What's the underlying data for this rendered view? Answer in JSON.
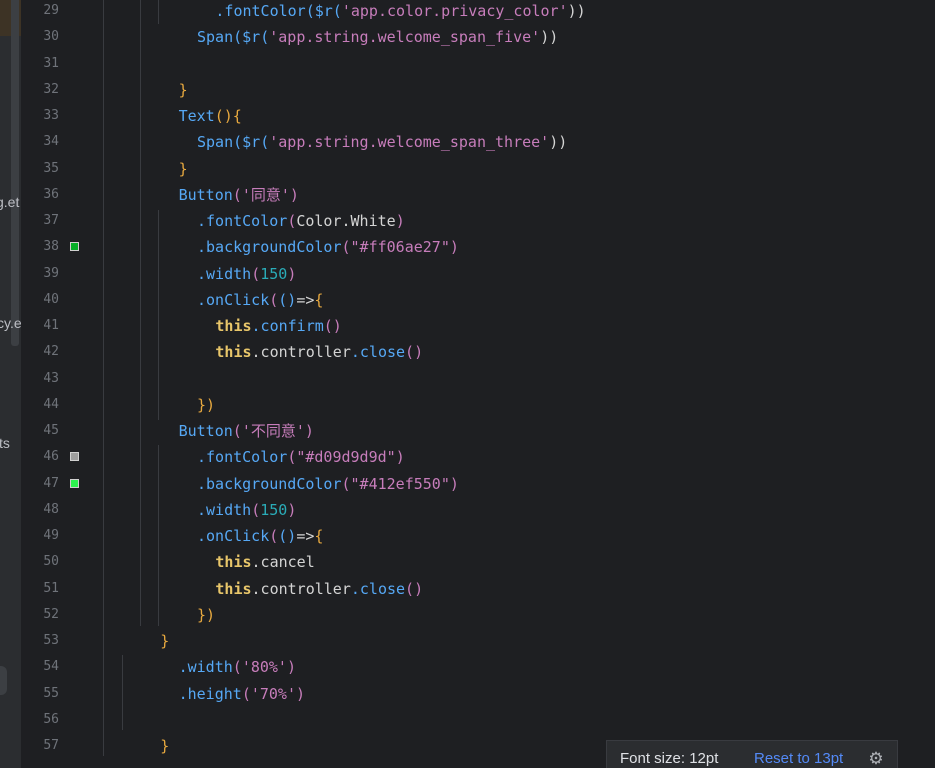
{
  "project_sidebar": {
    "fragments": [
      "g.et",
      "cy.e",
      "ts"
    ]
  },
  "editor": {
    "lines": [
      {
        "n": "29",
        "indent": 6,
        "tokens": [
          {
            "t": ".fontColor(",
            "c": "t-fn"
          },
          {
            "t": "$r(",
            "c": "t-fn"
          },
          {
            "t": "'app.color.privacy_color'",
            "c": "t-purple"
          },
          {
            "t": "))",
            "c": "t-white"
          }
        ]
      },
      {
        "n": "30",
        "indent": 5,
        "tokens": [
          {
            "t": "Span(",
            "c": "t-fn"
          },
          {
            "t": "$r(",
            "c": "t-fn"
          },
          {
            "t": "'app.string.welcome_span_five'",
            "c": "t-purple"
          },
          {
            "t": "))",
            "c": "t-white"
          }
        ]
      },
      {
        "n": "31",
        "indent": 0,
        "tokens": []
      },
      {
        "n": "32",
        "indent": 4,
        "tokens": [
          {
            "t": "}",
            "c": "t-bracket1"
          }
        ]
      },
      {
        "n": "33",
        "indent": 4,
        "tokens": [
          {
            "t": "Text",
            "c": "t-fn"
          },
          {
            "t": "()",
            "c": "t-bracket1"
          },
          {
            "t": "{",
            "c": "t-bracket1"
          }
        ]
      },
      {
        "n": "34",
        "indent": 5,
        "tokens": [
          {
            "t": "Span(",
            "c": "t-fn"
          },
          {
            "t": "$r(",
            "c": "t-fn"
          },
          {
            "t": "'app.string.welcome_span_three'",
            "c": "t-purple"
          },
          {
            "t": "))",
            "c": "t-white"
          }
        ]
      },
      {
        "n": "35",
        "indent": 4,
        "tokens": [
          {
            "t": "}",
            "c": "t-bracket1"
          }
        ]
      },
      {
        "n": "36",
        "indent": 4,
        "tokens": [
          {
            "t": "Button",
            "c": "t-fn"
          },
          {
            "t": "(",
            "c": "t-bracket2"
          },
          {
            "t": "'同意'",
            "c": "t-purple"
          },
          {
            "t": ")",
            "c": "t-bracket2"
          }
        ]
      },
      {
        "n": "37",
        "indent": 5,
        "tokens": [
          {
            "t": ".fontColor",
            "c": "t-fn"
          },
          {
            "t": "(",
            "c": "t-bracket2"
          },
          {
            "t": "Color.White",
            "c": "t-white"
          },
          {
            "t": ")",
            "c": "t-bracket2"
          }
        ]
      },
      {
        "n": "38",
        "indent": 5,
        "swatch": "#06ae27",
        "tokens": [
          {
            "t": ".backgroundColor",
            "c": "t-fn"
          },
          {
            "t": "(",
            "c": "t-bracket2"
          },
          {
            "t": "\"#ff06ae27\"",
            "c": "t-purple"
          },
          {
            "t": ")",
            "c": "t-bracket2"
          }
        ]
      },
      {
        "n": "39",
        "indent": 5,
        "tokens": [
          {
            "t": ".width",
            "c": "t-fn"
          },
          {
            "t": "(",
            "c": "t-bracket2"
          },
          {
            "t": "150",
            "c": "t-num"
          },
          {
            "t": ")",
            "c": "t-bracket2"
          }
        ]
      },
      {
        "n": "40",
        "indent": 5,
        "tokens": [
          {
            "t": ".onClick",
            "c": "t-fn"
          },
          {
            "t": "(",
            "c": "t-bracket2"
          },
          {
            "t": "()",
            "c": "t-fn"
          },
          {
            "t": "=>",
            "c": "t-white"
          },
          {
            "t": "{",
            "c": "t-bracket1"
          }
        ]
      },
      {
        "n": "41",
        "indent": 6,
        "tokens": [
          {
            "t": "this",
            "c": "t-this"
          },
          {
            "t": ".confirm",
            "c": "t-fn"
          },
          {
            "t": "()",
            "c": "t-bracket2"
          }
        ]
      },
      {
        "n": "42",
        "indent": 6,
        "tokens": [
          {
            "t": "this",
            "c": "t-this"
          },
          {
            "t": ".controller",
            "c": "t-white"
          },
          {
            "t": ".close",
            "c": "t-fn"
          },
          {
            "t": "()",
            "c": "t-bracket2"
          }
        ]
      },
      {
        "n": "43",
        "indent": 0,
        "tokens": []
      },
      {
        "n": "44",
        "indent": 5,
        "tokens": [
          {
            "t": "})",
            "c": "t-bracket1"
          }
        ]
      },
      {
        "n": "45",
        "indent": 4,
        "tokens": [
          {
            "t": "Button",
            "c": "t-fn"
          },
          {
            "t": "(",
            "c": "t-bracket2"
          },
          {
            "t": "'不同意'",
            "c": "t-purple"
          },
          {
            "t": ")",
            "c": "t-bracket2"
          }
        ]
      },
      {
        "n": "46",
        "indent": 5,
        "swatch": "#9d9d9d",
        "tokens": [
          {
            "t": ".fontColor",
            "c": "t-fn"
          },
          {
            "t": "(",
            "c": "t-bracket2"
          },
          {
            "t": "\"#d09d9d9d\"",
            "c": "t-purple"
          },
          {
            "t": ")",
            "c": "t-bracket2"
          }
        ]
      },
      {
        "n": "47",
        "indent": 5,
        "swatch": "#2ef550",
        "tokens": [
          {
            "t": ".backgroundColor",
            "c": "t-fn"
          },
          {
            "t": "(",
            "c": "t-bracket2"
          },
          {
            "t": "\"#412ef550\"",
            "c": "t-purple"
          },
          {
            "t": ")",
            "c": "t-bracket2"
          }
        ]
      },
      {
        "n": "48",
        "indent": 5,
        "tokens": [
          {
            "t": ".width",
            "c": "t-fn"
          },
          {
            "t": "(",
            "c": "t-bracket2"
          },
          {
            "t": "150",
            "c": "t-num"
          },
          {
            "t": ")",
            "c": "t-bracket2"
          }
        ]
      },
      {
        "n": "49",
        "indent": 5,
        "tokens": [
          {
            "t": ".onClick",
            "c": "t-fn"
          },
          {
            "t": "(",
            "c": "t-bracket2"
          },
          {
            "t": "()",
            "c": "t-fn"
          },
          {
            "t": "=>",
            "c": "t-white"
          },
          {
            "t": "{",
            "c": "t-bracket1"
          }
        ]
      },
      {
        "n": "50",
        "indent": 6,
        "tokens": [
          {
            "t": "this",
            "c": "t-this"
          },
          {
            "t": ".cancel",
            "c": "t-white"
          }
        ]
      },
      {
        "n": "51",
        "indent": 6,
        "tokens": [
          {
            "t": "this",
            "c": "t-this"
          },
          {
            "t": ".controller",
            "c": "t-white"
          },
          {
            "t": ".close",
            "c": "t-fn"
          },
          {
            "t": "()",
            "c": "t-bracket2"
          }
        ]
      },
      {
        "n": "52",
        "indent": 5,
        "tokens": [
          {
            "t": "})",
            "c": "t-bracket1"
          }
        ]
      },
      {
        "n": "53",
        "indent": 3,
        "tokens": [
          {
            "t": "}",
            "c": "t-bracket1"
          }
        ]
      },
      {
        "n": "54",
        "indent": 4,
        "tokens": [
          {
            "t": ".width",
            "c": "t-fn"
          },
          {
            "t": "(",
            "c": "t-bracket2"
          },
          {
            "t": "'80%'",
            "c": "t-purple"
          },
          {
            "t": ")",
            "c": "t-bracket2"
          }
        ]
      },
      {
        "n": "55",
        "indent": 4,
        "tokens": [
          {
            "t": ".height",
            "c": "t-fn"
          },
          {
            "t": "(",
            "c": "t-bracket2"
          },
          {
            "t": "'70%'",
            "c": "t-purple"
          },
          {
            "t": ")",
            "c": "t-bracket2"
          }
        ]
      },
      {
        "n": "56",
        "indent": 0,
        "tokens": []
      },
      {
        "n": "57",
        "indent": 3,
        "tokens": [
          {
            "t": "}",
            "c": "t-bracket1"
          }
        ]
      }
    ]
  },
  "font_popup": {
    "label": "Font size: 12pt",
    "reset_link": "Reset to 13pt",
    "icon": "gear-icon"
  }
}
